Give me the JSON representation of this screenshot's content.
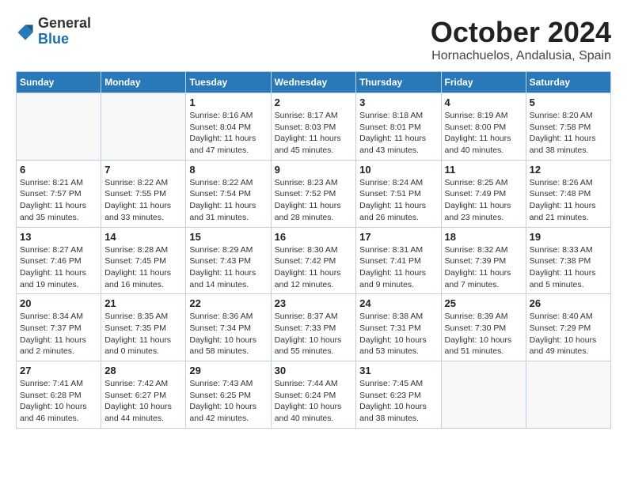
{
  "header": {
    "logo_general": "General",
    "logo_blue": "Blue",
    "month_title": "October 2024",
    "subtitle": "Hornachuelos, Andalusia, Spain"
  },
  "days_of_week": [
    "Sunday",
    "Monday",
    "Tuesday",
    "Wednesday",
    "Thursday",
    "Friday",
    "Saturday"
  ],
  "weeks": [
    [
      {
        "day": "",
        "info": ""
      },
      {
        "day": "",
        "info": ""
      },
      {
        "day": "1",
        "info": "Sunrise: 8:16 AM\nSunset: 8:04 PM\nDaylight: 11 hours and 47 minutes."
      },
      {
        "day": "2",
        "info": "Sunrise: 8:17 AM\nSunset: 8:03 PM\nDaylight: 11 hours and 45 minutes."
      },
      {
        "day": "3",
        "info": "Sunrise: 8:18 AM\nSunset: 8:01 PM\nDaylight: 11 hours and 43 minutes."
      },
      {
        "day": "4",
        "info": "Sunrise: 8:19 AM\nSunset: 8:00 PM\nDaylight: 11 hours and 40 minutes."
      },
      {
        "day": "5",
        "info": "Sunrise: 8:20 AM\nSunset: 7:58 PM\nDaylight: 11 hours and 38 minutes."
      }
    ],
    [
      {
        "day": "6",
        "info": "Sunrise: 8:21 AM\nSunset: 7:57 PM\nDaylight: 11 hours and 35 minutes."
      },
      {
        "day": "7",
        "info": "Sunrise: 8:22 AM\nSunset: 7:55 PM\nDaylight: 11 hours and 33 minutes."
      },
      {
        "day": "8",
        "info": "Sunrise: 8:22 AM\nSunset: 7:54 PM\nDaylight: 11 hours and 31 minutes."
      },
      {
        "day": "9",
        "info": "Sunrise: 8:23 AM\nSunset: 7:52 PM\nDaylight: 11 hours and 28 minutes."
      },
      {
        "day": "10",
        "info": "Sunrise: 8:24 AM\nSunset: 7:51 PM\nDaylight: 11 hours and 26 minutes."
      },
      {
        "day": "11",
        "info": "Sunrise: 8:25 AM\nSunset: 7:49 PM\nDaylight: 11 hours and 23 minutes."
      },
      {
        "day": "12",
        "info": "Sunrise: 8:26 AM\nSunset: 7:48 PM\nDaylight: 11 hours and 21 minutes."
      }
    ],
    [
      {
        "day": "13",
        "info": "Sunrise: 8:27 AM\nSunset: 7:46 PM\nDaylight: 11 hours and 19 minutes."
      },
      {
        "day": "14",
        "info": "Sunrise: 8:28 AM\nSunset: 7:45 PM\nDaylight: 11 hours and 16 minutes."
      },
      {
        "day": "15",
        "info": "Sunrise: 8:29 AM\nSunset: 7:43 PM\nDaylight: 11 hours and 14 minutes."
      },
      {
        "day": "16",
        "info": "Sunrise: 8:30 AM\nSunset: 7:42 PM\nDaylight: 11 hours and 12 minutes."
      },
      {
        "day": "17",
        "info": "Sunrise: 8:31 AM\nSunset: 7:41 PM\nDaylight: 11 hours and 9 minutes."
      },
      {
        "day": "18",
        "info": "Sunrise: 8:32 AM\nSunset: 7:39 PM\nDaylight: 11 hours and 7 minutes."
      },
      {
        "day": "19",
        "info": "Sunrise: 8:33 AM\nSunset: 7:38 PM\nDaylight: 11 hours and 5 minutes."
      }
    ],
    [
      {
        "day": "20",
        "info": "Sunrise: 8:34 AM\nSunset: 7:37 PM\nDaylight: 11 hours and 2 minutes."
      },
      {
        "day": "21",
        "info": "Sunrise: 8:35 AM\nSunset: 7:35 PM\nDaylight: 11 hours and 0 minutes."
      },
      {
        "day": "22",
        "info": "Sunrise: 8:36 AM\nSunset: 7:34 PM\nDaylight: 10 hours and 58 minutes."
      },
      {
        "day": "23",
        "info": "Sunrise: 8:37 AM\nSunset: 7:33 PM\nDaylight: 10 hours and 55 minutes."
      },
      {
        "day": "24",
        "info": "Sunrise: 8:38 AM\nSunset: 7:31 PM\nDaylight: 10 hours and 53 minutes."
      },
      {
        "day": "25",
        "info": "Sunrise: 8:39 AM\nSunset: 7:30 PM\nDaylight: 10 hours and 51 minutes."
      },
      {
        "day": "26",
        "info": "Sunrise: 8:40 AM\nSunset: 7:29 PM\nDaylight: 10 hours and 49 minutes."
      }
    ],
    [
      {
        "day": "27",
        "info": "Sunrise: 7:41 AM\nSunset: 6:28 PM\nDaylight: 10 hours and 46 minutes."
      },
      {
        "day": "28",
        "info": "Sunrise: 7:42 AM\nSunset: 6:27 PM\nDaylight: 10 hours and 44 minutes."
      },
      {
        "day": "29",
        "info": "Sunrise: 7:43 AM\nSunset: 6:25 PM\nDaylight: 10 hours and 42 minutes."
      },
      {
        "day": "30",
        "info": "Sunrise: 7:44 AM\nSunset: 6:24 PM\nDaylight: 10 hours and 40 minutes."
      },
      {
        "day": "31",
        "info": "Sunrise: 7:45 AM\nSunset: 6:23 PM\nDaylight: 10 hours and 38 minutes."
      },
      {
        "day": "",
        "info": ""
      },
      {
        "day": "",
        "info": ""
      }
    ]
  ]
}
